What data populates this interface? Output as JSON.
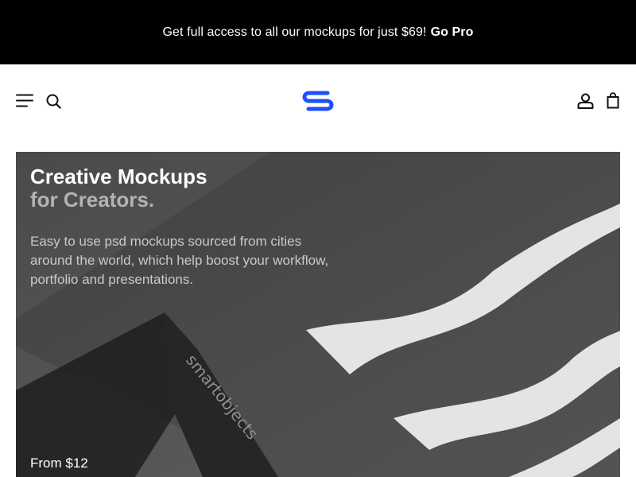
{
  "promo": {
    "text": "Get full access to all our mockups for just $69!",
    "link_label": "Go Pro"
  },
  "header": {
    "menu_icon": "hamburger-menu-icon",
    "search_icon": "search-icon",
    "logo_icon": "brand-logo",
    "account_icon": "user-account-icon",
    "cart_icon": "shopping-bag-icon",
    "logo_color": "#1d4fff"
  },
  "hero": {
    "title_line1": "Creative Mockups",
    "title_line2": "for Creators.",
    "description": "Easy to use psd mockups sourced from cities around the world, which help boost your workflow, portfolio and presentations.",
    "price": "From $12",
    "product_brand": "smartobjects"
  }
}
